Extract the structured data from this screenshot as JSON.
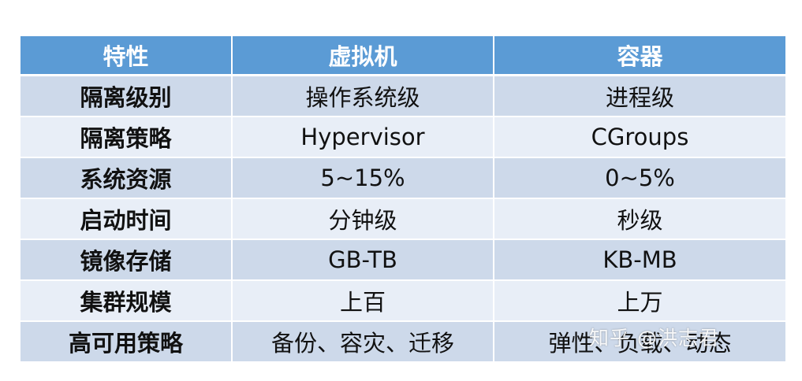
{
  "table": {
    "headers": [
      "特性",
      "虚拟机",
      "容器"
    ],
    "rows": [
      [
        "隔离级别",
        "操作系统级",
        "进程级"
      ],
      [
        "隔离策略",
        "Hypervisor",
        "CGroups"
      ],
      [
        "系统资源",
        "5~15%",
        "0~5%"
      ],
      [
        "启动时间",
        "分钟级",
        "秒级"
      ],
      [
        "镜像存储",
        "GB-TB",
        "KB-MB"
      ],
      [
        "集群规模",
        "上百",
        "上万"
      ],
      [
        "高可用策略",
        "备份、容灾、迁移",
        "弹性、负载、动态"
      ]
    ]
  },
  "colors": {
    "header_bg": "#5b9bd5",
    "row_odd_bg": "#cdd9ea",
    "row_even_bg": "#e8eef7"
  },
  "watermark": {
    "text": "知乎 @洪志君"
  }
}
